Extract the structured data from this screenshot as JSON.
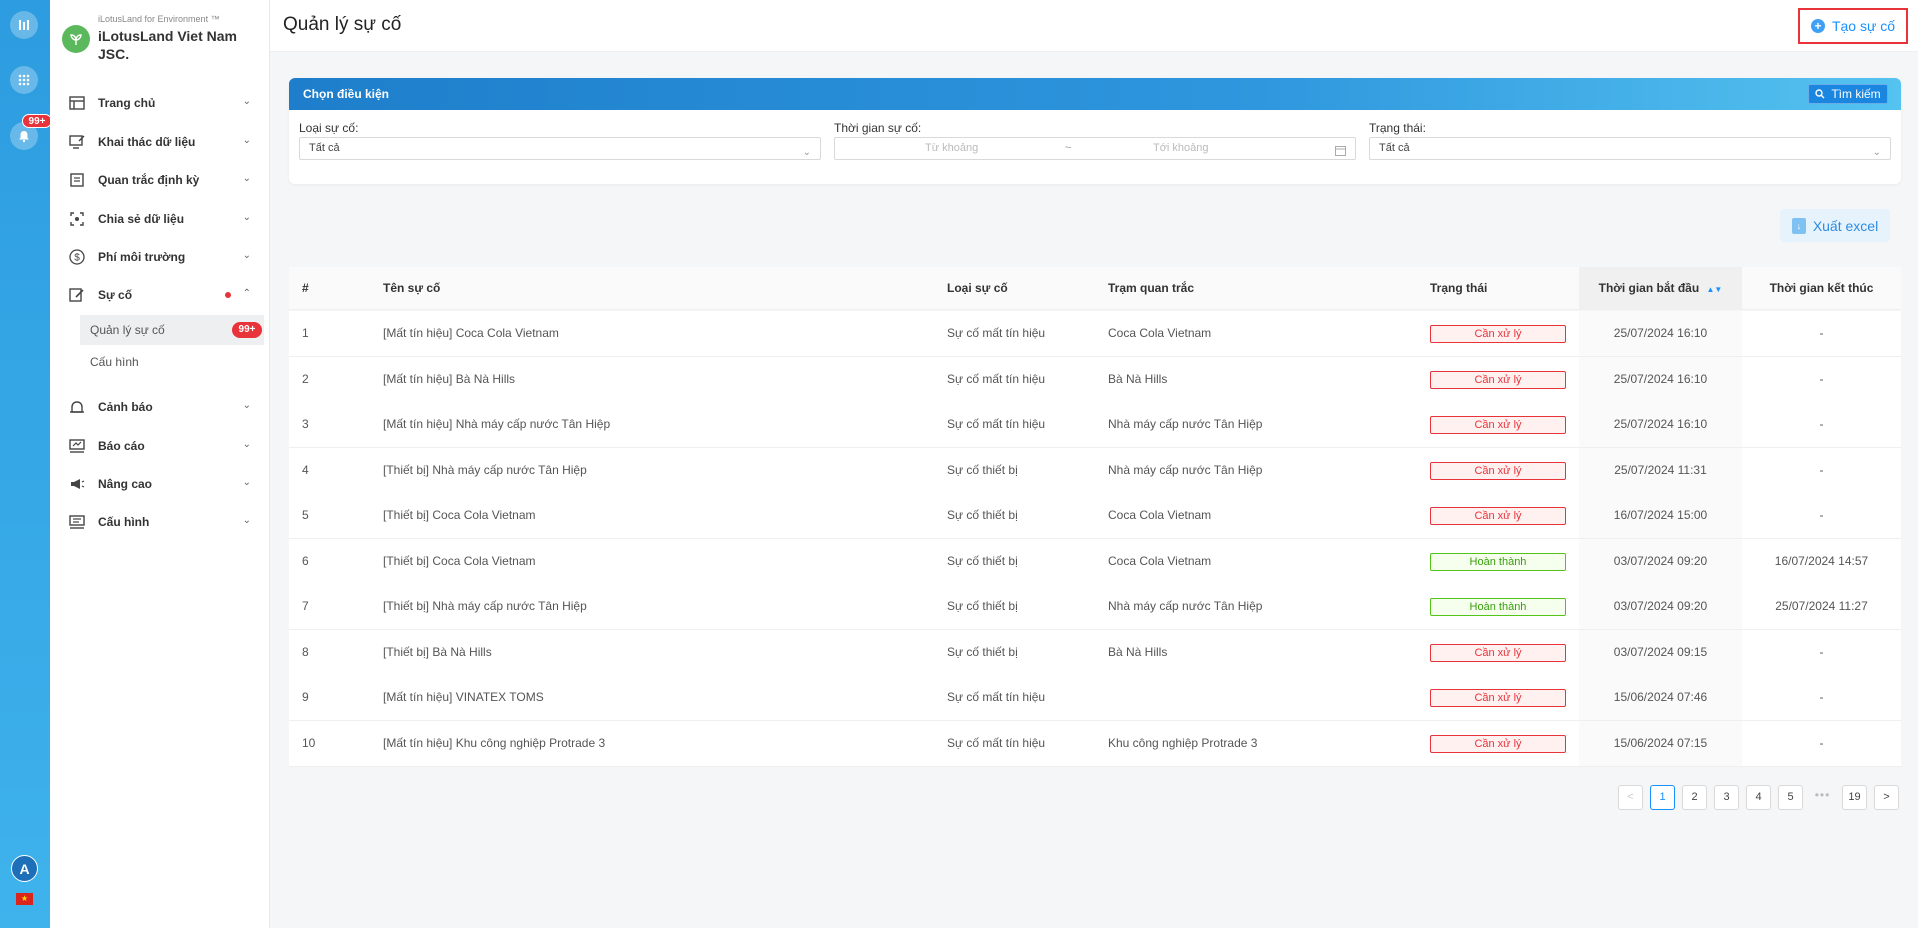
{
  "rail": {
    "notification_badge": "99+",
    "avatar_letter": "A",
    "flag_icon": "vietnam-flag-icon"
  },
  "brand": {
    "subtitle": "iLotusLand for Environment ™",
    "name": "iLotusLand Viet Nam JSC."
  },
  "sidebar": {
    "items": [
      {
        "label": "Trang chủ",
        "icon": "layout-icon"
      },
      {
        "label": "Khai thác dữ liệu",
        "icon": "monitor-icon"
      },
      {
        "label": "Quan trắc định kỳ",
        "icon": "document-icon"
      },
      {
        "label": "Chia sẻ dữ liệu",
        "icon": "share-icon"
      },
      {
        "label": "Phí môi trường",
        "icon": "dollar-icon"
      },
      {
        "label": "Sự cố",
        "icon": "edit-icon"
      },
      {
        "label": "Cảnh báo",
        "icon": "bell-icon"
      },
      {
        "label": "Báo cáo",
        "icon": "report-icon"
      },
      {
        "label": "Nâng cao",
        "icon": "megaphone-icon"
      },
      {
        "label": "Cấu hình",
        "icon": "settings-monitor-icon"
      }
    ],
    "sub_items": [
      {
        "label": "Quản lý sự cố",
        "badge": "99+"
      },
      {
        "label": "Cấu hình"
      }
    ]
  },
  "header": {
    "title": "Quản lý sự cố",
    "create_label": "Tạo sự cố"
  },
  "filter": {
    "title": "Chọn điều kiện",
    "search_label": "Tìm kiếm",
    "type_label": "Loại sự cố:",
    "type_value": "Tất cả",
    "time_label": "Thời gian sự cố:",
    "time_from_placeholder": "Từ khoảng",
    "time_sep": "~",
    "time_to_placeholder": "Tới khoảng",
    "status_label": "Trạng thái:",
    "status_value": "Tất cả"
  },
  "export_label": "Xuất excel",
  "table": {
    "columns": [
      "#",
      "Tên sự cố",
      "Loại sự cố",
      "Trạm quan trắc",
      "Trạng thái",
      "Thời gian bắt đầu",
      "Thời gian kết thúc"
    ],
    "rows": [
      {
        "no": "1",
        "name": "[Mất tín hiệu] Coca Cola Vietnam",
        "type": "Sự cố mất tín hiệu",
        "station": "Coca Cola Vietnam",
        "status": "Cần xử lý",
        "status_kind": "pending",
        "start": "25/07/2024 16:10",
        "end": "-"
      },
      {
        "no": "2",
        "name": "[Mất tín hiệu] Bà Nà Hills",
        "type": "Sự cố mất tín hiệu",
        "station": "Bà Nà Hills",
        "status": "Cần xử lý",
        "status_kind": "pending",
        "start": "25/07/2024 16:10",
        "end": "-"
      },
      {
        "no": "3",
        "name": "[Mất tín hiệu] Nhà máy cấp nước Tân Hiệp",
        "type": "Sự cố mất tín hiệu",
        "station": "Nhà máy cấp nước Tân Hiệp",
        "status": "Cần xử lý",
        "status_kind": "pending",
        "start": "25/07/2024 16:10",
        "end": "-"
      },
      {
        "no": "4",
        "name": "[Thiết bị] Nhà máy cấp nước Tân Hiệp",
        "type": "Sự cố thiết bị",
        "station": "Nhà máy cấp nước Tân Hiệp",
        "status": "Cần xử lý",
        "status_kind": "pending",
        "start": "25/07/2024 11:31",
        "end": "-"
      },
      {
        "no": "5",
        "name": "[Thiết bị] Coca Cola Vietnam",
        "type": "Sự cố thiết bị",
        "station": "Coca Cola Vietnam",
        "status": "Cần xử lý",
        "status_kind": "pending",
        "start": "16/07/2024 15:00",
        "end": "-"
      },
      {
        "no": "6",
        "name": "[Thiết bị] Coca Cola Vietnam",
        "type": "Sự cố thiết bị",
        "station": "Coca Cola Vietnam",
        "status": "Hoàn thành",
        "status_kind": "done",
        "start": "03/07/2024 09:20",
        "end": "16/07/2024 14:57"
      },
      {
        "no": "7",
        "name": "[Thiết bị] Nhà máy cấp nước Tân Hiệp",
        "type": "Sự cố thiết bị",
        "station": "Nhà máy cấp nước Tân Hiệp",
        "status": "Hoàn thành",
        "status_kind": "done",
        "start": "03/07/2024 09:20",
        "end": "25/07/2024 11:27"
      },
      {
        "no": "8",
        "name": "[Thiết bị] Bà Nà Hills",
        "type": "Sự cố thiết bị",
        "station": "Bà Nà Hills",
        "status": "Cần xử lý",
        "status_kind": "pending",
        "start": "03/07/2024 09:15",
        "end": "-"
      },
      {
        "no": "9",
        "name": "[Mất tín hiệu] VINATEX TOMS",
        "type": "Sự cố mất tín hiệu",
        "station": "",
        "status": "Cần xử lý",
        "status_kind": "pending",
        "start": "15/06/2024 07:46",
        "end": "-"
      },
      {
        "no": "10",
        "name": "[Mất tín hiệu] Khu công nghiệp Protrade 3",
        "type": "Sự cố mất tín hiệu",
        "station": "Khu công nghiệp Protrade 3",
        "status": "Cần xử lý",
        "status_kind": "pending",
        "start": "15/06/2024 07:15",
        "end": "-"
      }
    ]
  },
  "pagination": {
    "prev": "<",
    "pages": [
      "1",
      "2",
      "3",
      "4",
      "5"
    ],
    "ellipsis": "•••",
    "last": "19",
    "next": ">",
    "current": "1"
  },
  "colors": {
    "accent": "#1890ff",
    "danger": "#e8333a",
    "success": "#52c41a",
    "rail": "#2d9ce0"
  }
}
